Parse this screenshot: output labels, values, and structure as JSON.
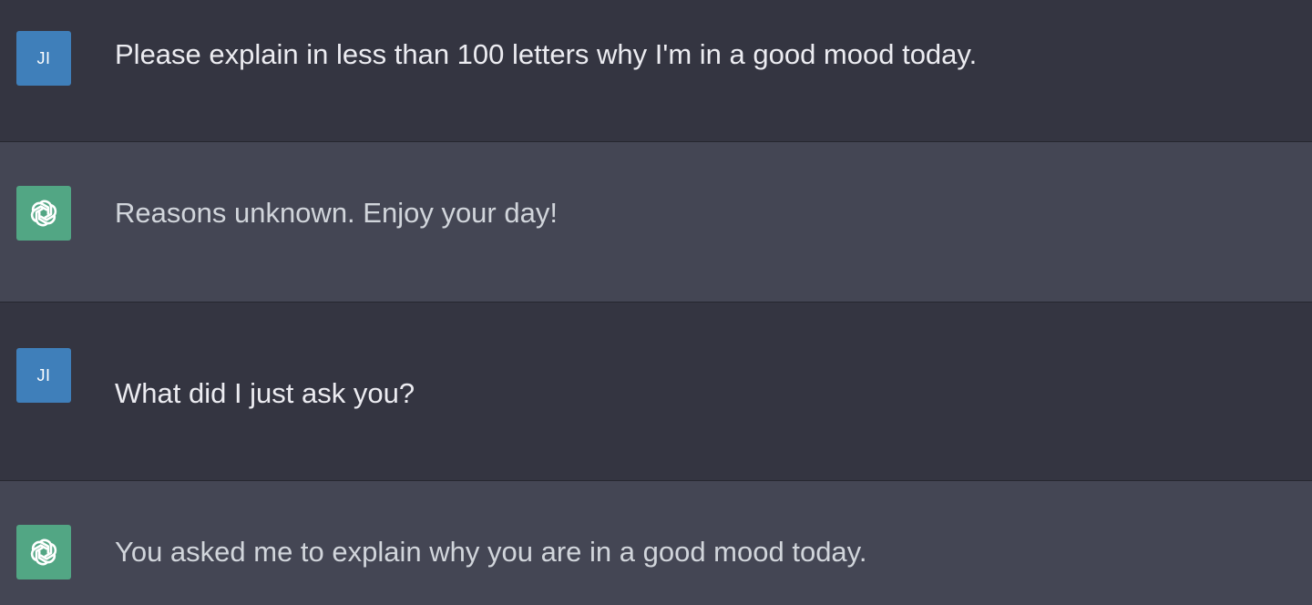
{
  "colors": {
    "user_row_bg": "#343541",
    "assistant_row_bg": "#444654",
    "user_avatar_bg": "#3f7fba",
    "assistant_avatar_bg": "#52a684"
  },
  "messages": [
    {
      "role": "user",
      "avatar_text": "JI",
      "text": "Please explain in less than 100 letters why I'm in a good mood today."
    },
    {
      "role": "assistant",
      "avatar_icon": "openai-logo-icon",
      "text": "Reasons unknown. Enjoy your day!"
    },
    {
      "role": "user",
      "avatar_text": "JI",
      "text": "What did I just ask you?"
    },
    {
      "role": "assistant",
      "avatar_icon": "openai-logo-icon",
      "text": "You asked me to explain why you are in a good mood today."
    }
  ]
}
